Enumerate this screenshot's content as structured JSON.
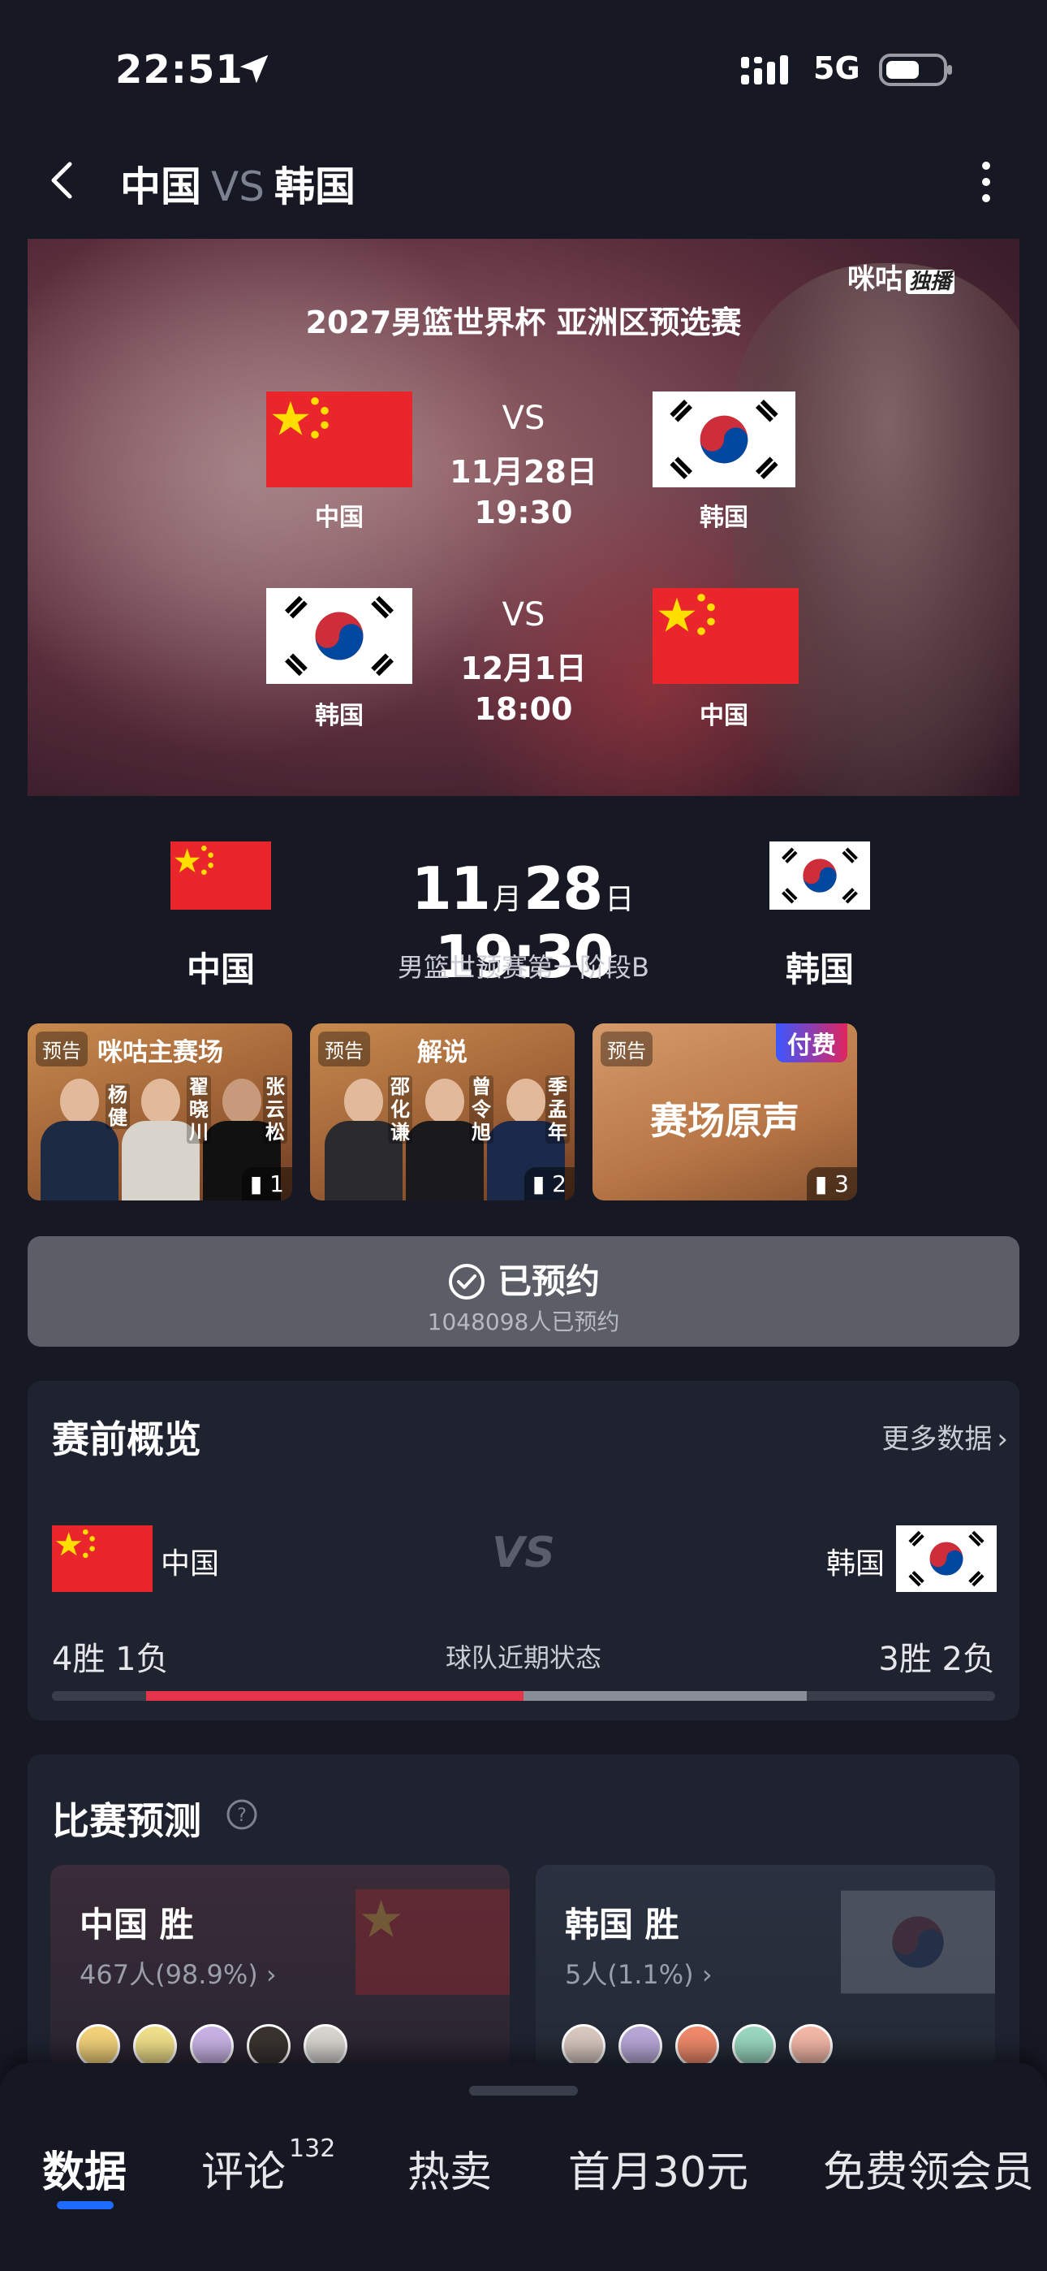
{
  "status_bar": {
    "time": "22:51",
    "network": "5G"
  },
  "nav": {
    "team_left": "中国",
    "vs": "VS",
    "team_right": "韩国"
  },
  "banner": {
    "brand": "咪咕",
    "brand_tag": "独播",
    "title": "2027男篮世界杯 亚洲区预选赛",
    "game1": {
      "home": "中国",
      "away": "韩国",
      "vs": "VS",
      "date": "11月28日",
      "time": "19:30"
    },
    "game2": {
      "home": "韩国",
      "away": "中国",
      "vs": "VS",
      "date": "12月1日",
      "time": "18:00"
    }
  },
  "match": {
    "team_left": "中国",
    "team_right": "韩国",
    "month": "11",
    "month_unit": "月",
    "day": "28",
    "day_unit": "日",
    "time": "19:30",
    "stage": "男篮世预赛第一阶段B"
  },
  "streams": [
    {
      "badge": "预告",
      "title": "咪咕主赛场",
      "names": [
        "杨健",
        "翟晓川",
        "张云松"
      ],
      "count": "1"
    },
    {
      "badge": "预告",
      "title": "解说",
      "names": [
        "邵化谦",
        "曾令旭",
        "季孟年"
      ],
      "count": "2"
    },
    {
      "badge": "预告",
      "title": "赛场原声",
      "paid_tag": "付费",
      "count": "3"
    }
  ],
  "reserve": {
    "label": "已预约",
    "count_text": "1048098人已预约"
  },
  "overview": {
    "title": "赛前概览",
    "more": "更多数据",
    "team_left": "中国",
    "team_right": "韩国",
    "vs": "VS",
    "left_record": "4胜 1负",
    "mid_label": "球队近期状态",
    "right_record": "3胜 2负",
    "left_win_fraction": 0.8,
    "right_win_fraction": 0.6
  },
  "prediction": {
    "title": "比赛预测",
    "left": {
      "label": "中国 胜",
      "sub": "467人(98.9%)"
    },
    "right": {
      "label": "韩国 胜",
      "sub": "5人(1.1%)"
    }
  },
  "tabs": [
    {
      "label": "数据",
      "active": true
    },
    {
      "label": "评论",
      "badge": "132"
    },
    {
      "label": "热卖"
    },
    {
      "label": "首月30元"
    },
    {
      "label": "免费领会员"
    }
  ],
  "colors": {
    "accent_blue": "#1e6bff",
    "record_red": "#e5334b",
    "record_gray": "#8a8d96",
    "china_red": "#e8262b"
  }
}
